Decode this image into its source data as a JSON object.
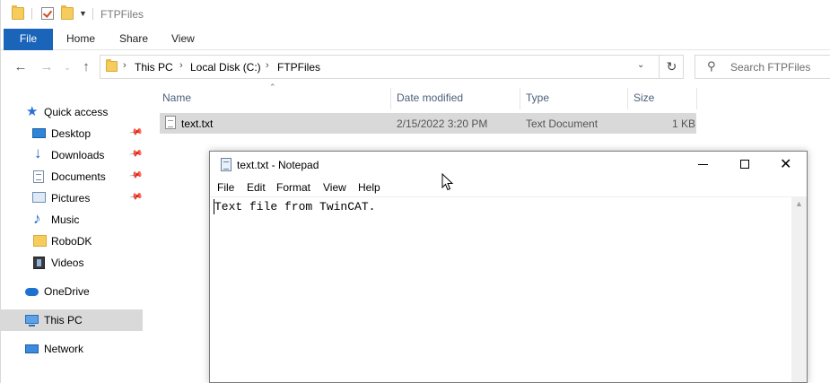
{
  "explorer": {
    "title": "FTPFiles",
    "ribbon_tabs": [
      "File",
      "Home",
      "Share",
      "View"
    ],
    "breadcrumb": [
      "This PC",
      "Local Disk (C:)",
      "FTPFiles"
    ],
    "search_placeholder": "Search FTPFiles",
    "nav": {
      "quick_access": "Quick access",
      "items": [
        {
          "label": "Desktop",
          "icon": "desktop-icon",
          "pinned": true
        },
        {
          "label": "Downloads",
          "icon": "downloads-icon",
          "pinned": true
        },
        {
          "label": "Documents",
          "icon": "documents-icon",
          "pinned": true
        },
        {
          "label": "Pictures",
          "icon": "pictures-icon",
          "pinned": true
        },
        {
          "label": "Music",
          "icon": "music-icon",
          "pinned": false
        },
        {
          "label": "RoboDK",
          "icon": "folder-icon",
          "pinned": false
        },
        {
          "label": "Videos",
          "icon": "videos-icon",
          "pinned": false
        }
      ],
      "onedrive": "OneDrive",
      "this_pc": "This PC",
      "network": "Network"
    },
    "columns": {
      "name": "Name",
      "date": "Date modified",
      "type": "Type",
      "size": "Size"
    },
    "files": [
      {
        "name": "text.txt",
        "date": "2/15/2022 3:20 PM",
        "type": "Text Document",
        "size": "1 KB"
      }
    ]
  },
  "notepad": {
    "title": "text.txt - Notepad",
    "menu": [
      "File",
      "Edit",
      "Format",
      "View",
      "Help"
    ],
    "content": "Text file from TwinCAT."
  },
  "colors": {
    "ribbon_file_tab": "#1a64ba",
    "selection": "#d9d9d9",
    "header_text": "#4c607a"
  }
}
